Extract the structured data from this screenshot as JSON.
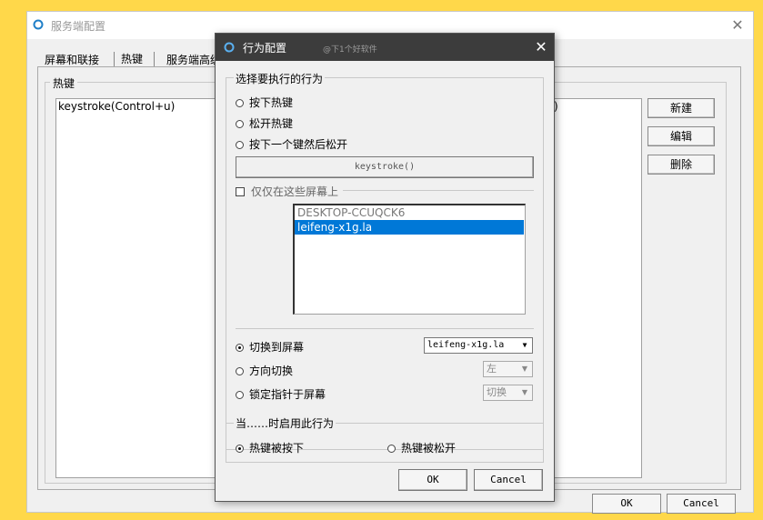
{
  "main": {
    "title": "服务端配置",
    "tabs": [
      "屏幕和联接",
      "热键",
      "服务端高级"
    ],
    "hotkey_group_label": "热键",
    "hotkey_row_left": "keystroke(Control+u)",
    "hotkey_row_right": ")",
    "buttons": {
      "new": "新建",
      "edit": "编辑",
      "delete": "删除",
      "ok": "OK",
      "cancel": "Cancel"
    }
  },
  "dialog": {
    "title": "行为配置",
    "watermark": "@下1个好软件",
    "behavior_label": "选择要执行的行为",
    "options": [
      "按下热键",
      "松开热键",
      "按下一个键然后松开"
    ],
    "keystroke_button": "keystroke()",
    "only_screens_label": "仅仅在这些屏幕上",
    "screens": [
      "DESKTOP-CCUQCK6",
      "leifeng-x1g.la"
    ],
    "action_options": [
      "切换到屏幕",
      "方向切换",
      "锁定指针于屏幕"
    ],
    "selects": {
      "screen": "leifeng-x1g.la",
      "direction": "左",
      "lock": "切换"
    },
    "when_label": "当……时启用此行为",
    "when_options": [
      "热键被按下",
      "热键被松开"
    ],
    "ok": "OK",
    "cancel": "Cancel"
  },
  "colors": {
    "background": "#ffd84a",
    "selection": "#0078d7",
    "dialog_title_bar": "#3c3c3c"
  }
}
